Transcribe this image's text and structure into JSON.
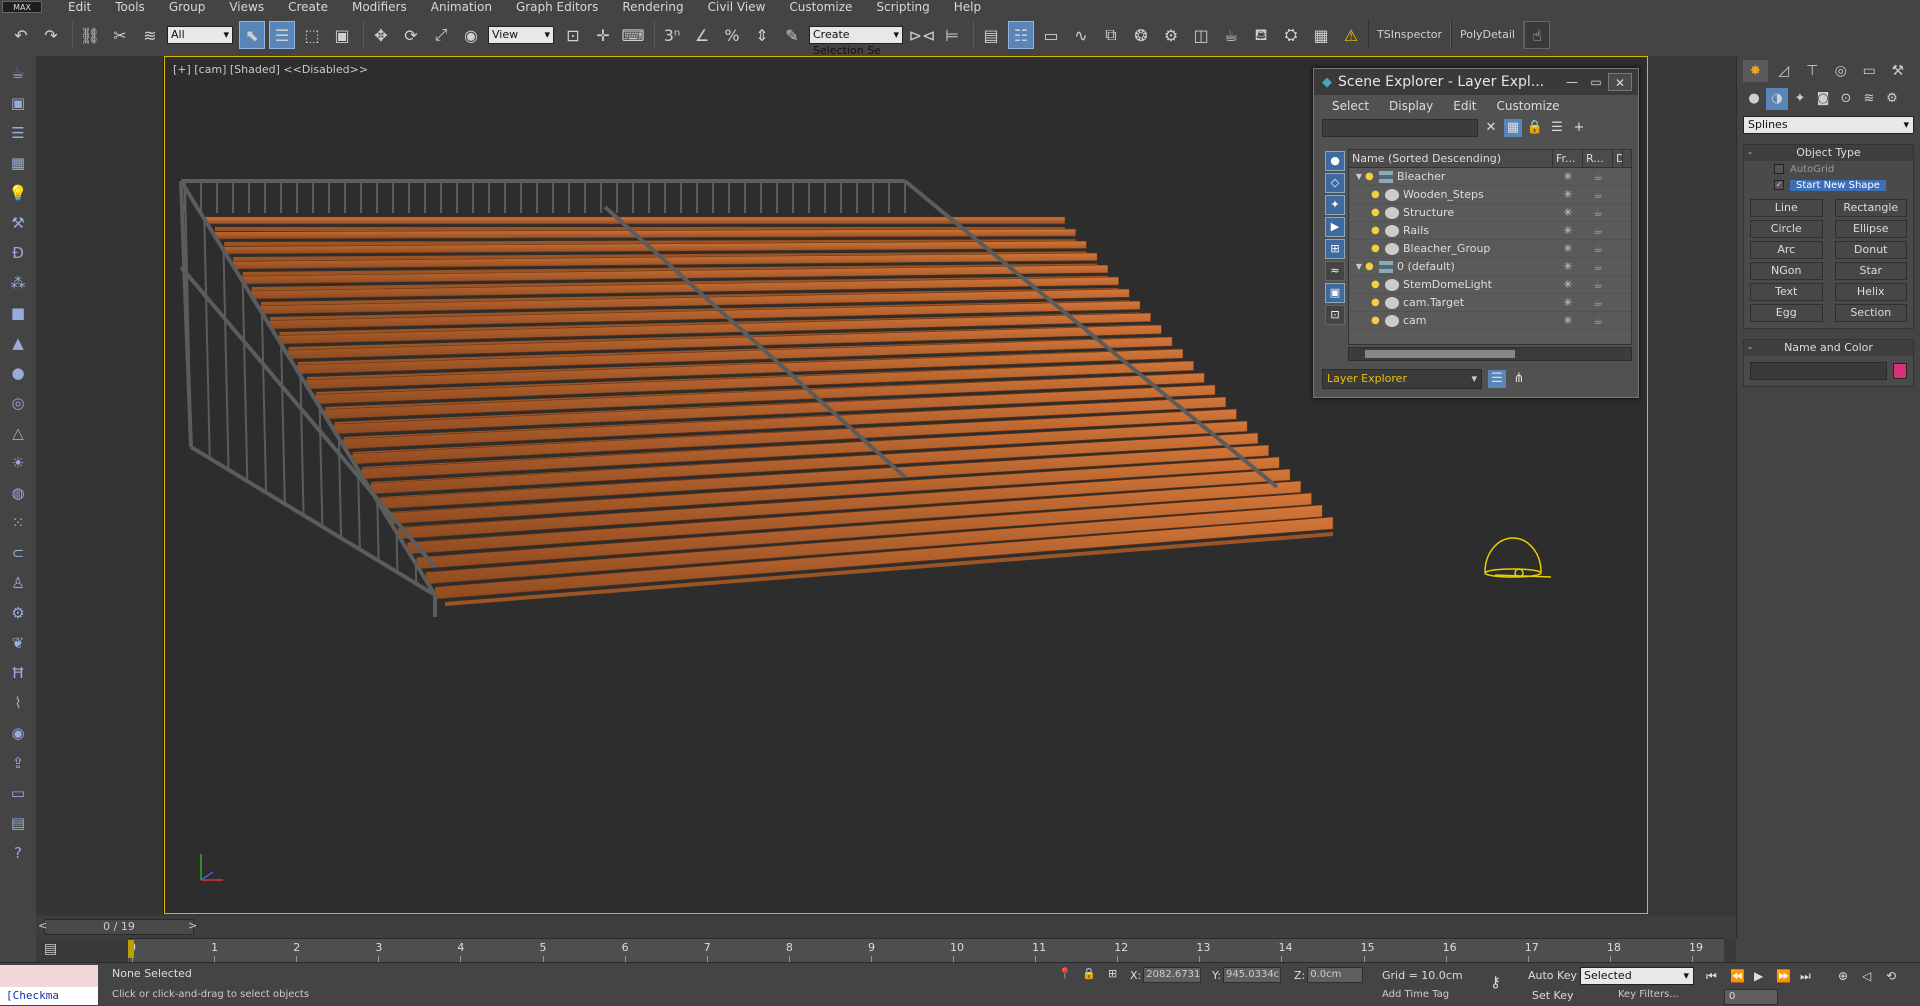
{
  "menu": {
    "logo": "MAX",
    "items": [
      "Edit",
      "Tools",
      "Group",
      "Views",
      "Create",
      "Modifiers",
      "Animation",
      "Graph Editors",
      "Rendering",
      "Civil View",
      "Customize",
      "Scripting",
      "Help"
    ]
  },
  "toolbar": {
    "selection_filter": "All",
    "reference_coord": "View",
    "named_selection": "Create Selection Se",
    "plugin_buttons": [
      "TSInspector",
      "PolyDetail"
    ]
  },
  "viewport": {
    "label": "[+] [cam] [Shaded]  <<Disabled>>",
    "axis_x": "x",
    "axis_y": "y",
    "axis_z": "z"
  },
  "scene_explorer": {
    "title": "Scene Explorer - Layer Expl...",
    "menus": [
      "Select",
      "Display",
      "Edit",
      "Customize"
    ],
    "columns": [
      "Name (Sorted Descending)",
      "Fr...",
      "R...",
      "D"
    ],
    "rows": [
      {
        "name": "Bleacher",
        "indent": 0,
        "type": "layer",
        "expanded": true
      },
      {
        "name": "Wooden_Steps",
        "indent": 1,
        "type": "object"
      },
      {
        "name": "Structure",
        "indent": 1,
        "type": "object"
      },
      {
        "name": "Rails",
        "indent": 1,
        "type": "object"
      },
      {
        "name": "Bleacher_Group",
        "indent": 1,
        "type": "group"
      },
      {
        "name": "0 (default)",
        "indent": 0,
        "type": "layer",
        "expanded": true
      },
      {
        "name": "StemDomeLight",
        "indent": 1,
        "type": "light"
      },
      {
        "name": "cam.Target",
        "indent": 1,
        "type": "camera"
      },
      {
        "name": "cam",
        "indent": 1,
        "type": "camera"
      }
    ],
    "footer_mode": "Layer Explorer"
  },
  "command_panel": {
    "category": "Splines",
    "object_type": {
      "title": "Object Type",
      "autogrid": "AutoGrid",
      "start_new_shape": "Start New Shape",
      "buttons": [
        "Line",
        "Rectangle",
        "Circle",
        "Ellipse",
        "Arc",
        "Donut",
        "NGon",
        "Star",
        "Text",
        "Helix",
        "Egg",
        "Section"
      ]
    },
    "name_color": {
      "title": "Name and Color",
      "color": "#d8307a"
    }
  },
  "timeline": {
    "slider_label": "0 / 19",
    "ticks": [
      "0",
      "1",
      "2",
      "3",
      "4",
      "5",
      "6",
      "7",
      "8",
      "9",
      "10",
      "11",
      "12",
      "13",
      "14",
      "15",
      "16",
      "17",
      "18",
      "19"
    ]
  },
  "status": {
    "maxscript_text": "[Checkma",
    "selection": "None Selected",
    "prompt": "Click or click-and-drag to select objects",
    "x_label": "X:",
    "x_value": "2082.6731",
    "y_label": "Y:",
    "y_value": "945.0334c",
    "z_label": "Z:",
    "z_value": "0.0cm",
    "grid": "Grid = 10.0cm",
    "add_time_tag": "Add Time Tag",
    "auto_key": "Auto Key",
    "set_key": "Set Key",
    "key_mode": "Selected",
    "key_filters": "Key Filters...",
    "current_frame": "0"
  },
  "colors": {
    "accent": "#5a85b8",
    "viewport_border": "#d7b800",
    "wood": "#b8612a"
  }
}
